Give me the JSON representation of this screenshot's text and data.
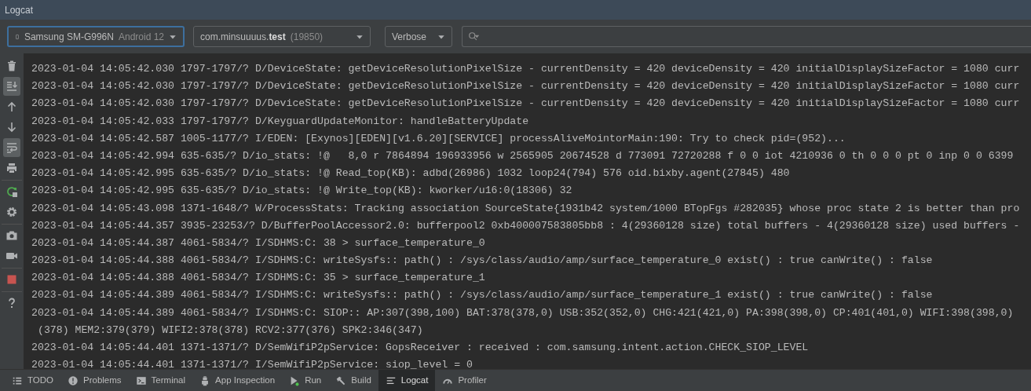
{
  "window": {
    "title": "Logcat"
  },
  "toolbar": {
    "device": {
      "name": "Samsung SM-G996N",
      "version": "Android 12",
      "focused": true
    },
    "process": {
      "package": "com.minsuuuus.**test**",
      "pid": "(19850)"
    },
    "level": "Verbose"
  },
  "sidebar": {
    "groups": [
      {
        "tools": [
          {
            "kind": "trash",
            "on": false
          },
          {
            "kind": "scroll-end",
            "on": true
          },
          {
            "kind": "up",
            "on": false
          },
          {
            "kind": "down",
            "on": false
          },
          {
            "kind": "wrap",
            "on": true
          },
          {
            "kind": "print",
            "on": false
          }
        ]
      },
      {
        "tools": [
          {
            "kind": "restart",
            "on": false
          },
          {
            "kind": "gear",
            "on": false
          }
        ]
      },
      {
        "tools": [
          {
            "kind": "camera",
            "on": false
          },
          {
            "kind": "video",
            "on": false
          }
        ]
      },
      {
        "tools": [
          {
            "kind": "stop",
            "on": false
          }
        ]
      },
      {
        "tools": [
          {
            "kind": "help",
            "on": false
          }
        ]
      }
    ]
  },
  "log": [
    {
      "text": "2023-01-04 14:05:42.030 1797-1797/? D/DeviceState: getDeviceResolutionPixelSize - currentDensity = 420 deviceDensity = 420 initialDisplaySizeFactor = 1080 curr"
    },
    {
      "text": "2023-01-04 14:05:42.030 1797-1797/? D/DeviceState: getDeviceResolutionPixelSize - currentDensity = 420 deviceDensity = 420 initialDisplaySizeFactor = 1080 curr"
    },
    {
      "text": "2023-01-04 14:05:42.030 1797-1797/? D/DeviceState: getDeviceResolutionPixelSize - currentDensity = 420 deviceDensity = 420 initialDisplaySizeFactor = 1080 curr"
    },
    {
      "text": "2023-01-04 14:05:42.033 1797-1797/? D/KeyguardUpdateMonitor: handleBatteryUpdate"
    },
    {
      "text": "2023-01-04 14:05:42.587 1005-1177/? I/EDEN: [Exynos][EDEN][v1.6.20][SERVICE] processAliveMointorMain:190: Try to check pid=(952)..."
    },
    {
      "text": "2023-01-04 14:05:42.994 635-635/? D/io_stats: !@   8,0 r 7864894 196933956 w 2565905 20674528 d 773091 72720288 f 0 0 iot 4210936 0 th 0 0 0 pt 0 inp 0 0 6399"
    },
    {
      "text": "2023-01-04 14:05:42.995 635-635/? D/io_stats: !@ Read_top(KB): adbd(26986) 1032 loop24(794) 576 oid.bixby.agent(27845) 480"
    },
    {
      "text": "2023-01-04 14:05:42.995 635-635/? D/io_stats: !@ Write_top(KB): kworker/u16:0(18306) 32"
    },
    {
      "text": "2023-01-04 14:05:43.098 1371-1648/? W/ProcessStats: Tracking association SourceState{1931b42 system/1000 BTopFgs #282035} whose proc state 2 is better than pro"
    },
    {
      "text": "2023-01-04 14:05:44.357 3935-23253/? D/BufferPoolAccessor2.0: bufferpool2 0xb400007583805bb8 : 4(29360128 size) total buffers - 4(29360128 size) used buffers -"
    },
    {
      "text": "2023-01-04 14:05:44.387 4061-5834/? I/SDHMS:C: 38 > surface_temperature_0"
    },
    {
      "text": "2023-01-04 14:05:44.388 4061-5834/? I/SDHMS:C: writeSysfs:: path() : /sys/class/audio/amp/surface_temperature_0 exist() : true canWrite() : false"
    },
    {
      "text": "2023-01-04 14:05:44.388 4061-5834/? I/SDHMS:C: 35 > surface_temperature_1"
    },
    {
      "text": "2023-01-04 14:05:44.389 4061-5834/? I/SDHMS:C: writeSysfs:: path() : /sys/class/audio/amp/surface_temperature_1 exist() : true canWrite() : false"
    },
    {
      "text": "2023-01-04 14:05:44.389 4061-5834/? I/SDHMS:C: SIOP:: AP:307(398,100) BAT:378(378,0) USB:352(352,0) CHG:421(421,0) PA:398(398,0) CP:401(401,0) WIFI:398(398,0)",
      "continuation": "(378) MEM2:379(379) WIFI2:378(378) RCV2:377(376) SPK2:346(347)"
    },
    {
      "text": "2023-01-04 14:05:44.401 1371-1371/? D/SemWifiP2pService: GopsReceiver : received : com.samsung.intent.action.CHECK_SIOP_LEVEL"
    },
    {
      "text": "2023-01-04 14:05:44.401 1371-1371/? I/SemWifiP2pService: siop_level = 0"
    }
  ],
  "bottom_tabs": [
    {
      "kind": "list",
      "label": "TODO",
      "selected": false
    },
    {
      "kind": "problems",
      "label": "Problems",
      "selected": false
    },
    {
      "kind": "terminal",
      "label": "Terminal",
      "selected": false
    },
    {
      "kind": "inspection",
      "label": "App Inspection",
      "selected": false
    },
    {
      "kind": "run",
      "label": "Run",
      "selected": false
    },
    {
      "kind": "build",
      "label": "Build",
      "selected": false
    },
    {
      "kind": "logcat",
      "label": "Logcat",
      "selected": true
    },
    {
      "kind": "profiler",
      "label": "Profiler",
      "selected": false
    }
  ]
}
